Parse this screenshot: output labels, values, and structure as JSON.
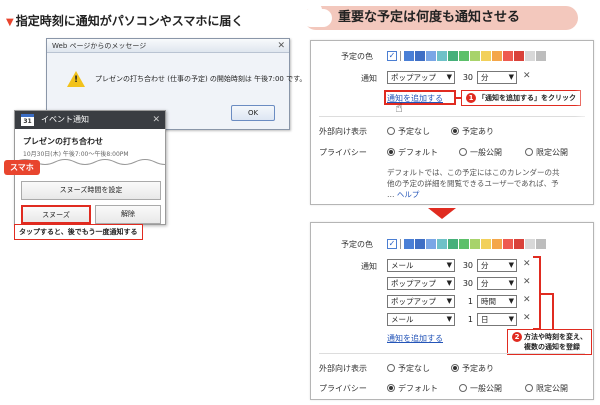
{
  "left": {
    "heading": "指定時刻に通知がパソコンやスマホに届く",
    "dialog": {
      "title": "Web ページからのメッセージ",
      "message": "プレゼンの打ち合わせ (仕事の予定) の開始時刻は 午後7:00 です。",
      "ok_label": "OK"
    },
    "notification": {
      "header": "イベント通知",
      "calendar_day": "31",
      "event_title": "プレゼンの打ち合わせ",
      "event_time": "10月30日(木) 午後7:00〜午後8:00PM",
      "snooze_time_label": "スヌーズ時間を設定",
      "snooze_label": "スヌーズ",
      "dismiss_label": "解除"
    },
    "smartphone_tag": "スマホ",
    "caption": "タップすると、後でもう一度通知する"
  },
  "right": {
    "heading": "重要な予定は何度も通知させる",
    "colors": [
      "#4a7fd6",
      "#3f6fc5",
      "#7aa6e6",
      "#6ec1c8",
      "#45b07a",
      "#5cc06a",
      "#a8d36b",
      "#f2d05a",
      "#f4a64a",
      "#ee5a4f",
      "#d9423a",
      "#d8d8d8",
      "#bdbdbd"
    ],
    "card1": {
      "color_label": "予定の色",
      "notify_label": "通知",
      "notify_rows": [
        {
          "method": "ポップアップ",
          "amount": "30",
          "unit": "分"
        }
      ],
      "add_notification_link": "通知を追加する",
      "callout_num": "1",
      "callout": "「通知を追加する」をクリック",
      "visibility_label": "外部向け表示",
      "visibility_options": [
        "予定なし",
        "予定あり"
      ],
      "privacy_label": "プライバシー",
      "privacy_options": [
        "デフォルト",
        "一般公開",
        "限定公開"
      ],
      "description_lines": [
        "デフォルトでは、この予定にはこのカレンダーの共",
        "他の予定の詳細を閲覧できるユーザーであれば、予"
      ],
      "help_link": "ヘルプ"
    },
    "card2": {
      "color_label": "予定の色",
      "notify_label": "通知",
      "notify_rows": [
        {
          "method": "メール",
          "amount": "30",
          "unit": "分"
        },
        {
          "method": "ポップアップ",
          "amount": "30",
          "unit": "分"
        },
        {
          "method": "ポップアップ",
          "amount": "1",
          "unit": "時間"
        },
        {
          "method": "メール",
          "amount": "1",
          "unit": "日"
        }
      ],
      "add_notification_link": "通知を追加する",
      "callout_num": "2",
      "callout_lines": [
        "方法や時刻を変え、",
        "複数の通知を登録"
      ],
      "visibility_label": "外部向け表示",
      "visibility_options": [
        "予定なし",
        "予定あり"
      ],
      "privacy_label": "プライバシー",
      "privacy_options": [
        "デフォルト",
        "一般公開",
        "限定公開"
      ]
    }
  }
}
